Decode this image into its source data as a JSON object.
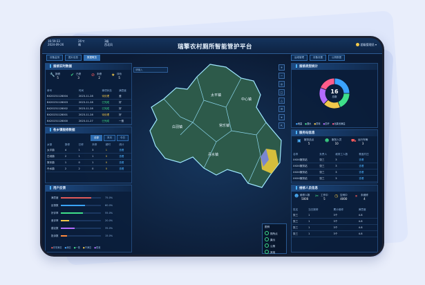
{
  "header": {
    "time_line1": "16:59:33",
    "time_line2": "2024-09-26",
    "weather_temp": "26℃",
    "weather_icon": "晴",
    "wind": "3级",
    "wind_dir": "西北风",
    "title": "瑞擎农村厕所智能管护平台",
    "user": "超级管理员"
  },
  "left_tabs": [
    "设备监测",
    "图片信息",
    "数据概览"
  ],
  "right_tabs": [
    "运维管理",
    "设备设置",
    "公厕数据"
  ],
  "panel_device": {
    "title": "报修实时数据",
    "stats": [
      {
        "label": "报修",
        "value": "5"
      },
      {
        "label": "已修",
        "value": "3"
      },
      {
        "label": "未修",
        "value": "2"
      },
      {
        "label": "评价",
        "value": "5"
      }
    ],
    "columns": [
      "单号",
      "时间",
      "事项状态",
      "满意度"
    ],
    "rows": [
      [
        "BX20231128004",
        "2023-11-28",
        "待处理",
        "差"
      ],
      [
        "BX20231128003",
        "2023-11-28",
        "已完成",
        "好"
      ],
      [
        "BX20231128002",
        "2023-11-28",
        "已完成",
        "好"
      ],
      [
        "BX20231128001",
        "2023-11-28",
        "待处理",
        "好"
      ],
      [
        "BX20231128000",
        "2023-11-27",
        "已完成",
        "一般"
      ]
    ]
  },
  "panel_town": {
    "title": "各乡镇报修数据",
    "filters": [
      "全部",
      "本月",
      "今日"
    ],
    "columns": [
      "乡镇",
      "报修",
      "已修",
      "未修",
      "超时",
      "统计"
    ],
    "rows": [
      [
        "太平镇",
        "4",
        "1",
        "3",
        "1",
        "查看"
      ],
      [
        "白羽镇",
        "2",
        "1",
        "1",
        "0",
        "查看"
      ],
      [
        "常乐镇",
        "1",
        "0",
        "1",
        "0",
        "查看"
      ],
      [
        "丹水镇",
        "2",
        "2",
        "0",
        "0",
        "查看"
      ]
    ]
  },
  "panel_user": {
    "title": "用户反馈",
    "bars": [
      {
        "label": "满意度",
        "pct": "75.0%",
        "fill": 0.75,
        "color": "#e05a5a"
      },
      {
        "label": "反馈数",
        "pct": "60.0%",
        "fill": 0.6,
        "color": "#3aa3ff"
      },
      {
        "label": "好评率",
        "pct": "55.0%",
        "fill": 0.55,
        "color": "#3fe08a"
      },
      {
        "label": "差评率",
        "pct": "20.0%",
        "fill": 0.2,
        "color": "#f2c84b"
      },
      {
        "label": "建议数",
        "pct": "35.0%",
        "fill": 0.35,
        "color": "#b36bff"
      },
      {
        "label": "投诉数",
        "pct": "15.0%",
        "fill": 0.15,
        "color": "#ff8a3d"
      }
    ],
    "legend": [
      "非常满意",
      "满意",
      "一般",
      "不满意",
      "很差"
    ]
  },
  "map": {
    "search_placeholder": "请输入",
    "towns": [
      "太平镇",
      "白羽镇",
      "常乐镇",
      "丹水镇",
      "中心镇"
    ],
    "legend_title": "图例",
    "legend_items": [
      "厕所点",
      "粪污",
      "公厕",
      "其他"
    ],
    "buttons": [
      "+",
      "−",
      "◎",
      "□",
      "△",
      "☰",
      "⌖",
      "⇱"
    ]
  },
  "panel_type": {
    "title": "报修类型统计",
    "center_value": "16",
    "center_label": "总数",
    "legend": [
      "堵塞",
      "漏水",
      "异味",
      "损坏",
      "化粪池满溢"
    ],
    "slices": [
      {
        "label": "堵塞",
        "value": 4,
        "color": "#3aa3ff"
      },
      {
        "label": "漏水",
        "value": 3,
        "color": "#3fe08a"
      },
      {
        "label": "异味",
        "value": 3,
        "color": "#f2c84b"
      },
      {
        "label": "损坏",
        "value": 3,
        "color": "#b36bff"
      },
      {
        "label": "化粪池满溢",
        "value": 3,
        "color": "#ff5c8a"
      }
    ]
  },
  "panel_station": {
    "title": "服务站信息",
    "stats": [
      {
        "label": "服务站点",
        "value": "5"
      },
      {
        "label": "服务人员",
        "value": "10"
      },
      {
        "label": "运行车辆",
        "value": "3"
      }
    ],
    "columns": [
      "名称",
      "负责人",
      "维修工人数",
      "覆盖村庄"
    ],
    "rows": [
      [
        "XXXX服务站",
        "张三",
        "3",
        "查看"
      ],
      [
        "XXXX服务站",
        "张三",
        "3",
        "查看"
      ],
      [
        "XXXX服务站",
        "张三",
        "3",
        "查看"
      ],
      [
        "XXXX服务站",
        "张三",
        "3",
        "查看"
      ]
    ]
  },
  "panel_staff": {
    "title": "维修人员信息",
    "stats": [
      {
        "label": "维修人数",
        "value": "5000"
      },
      {
        "label": "工作中",
        "value": "5"
      },
      {
        "label": "空闲中",
        "value": "4000"
      },
      {
        "label": "未维修",
        "value": "4"
      }
    ],
    "columns": [
      "姓名",
      "当日报修",
      "累计维修",
      "满意度"
    ],
    "rows": [
      [
        "张三",
        "1",
        "3个",
        "4.8"
      ],
      [
        "张三",
        "1",
        "3个",
        "4.8"
      ],
      [
        "张三",
        "1",
        "3个",
        "4.8"
      ],
      [
        "张三",
        "1",
        "3个",
        "4.8"
      ]
    ]
  }
}
